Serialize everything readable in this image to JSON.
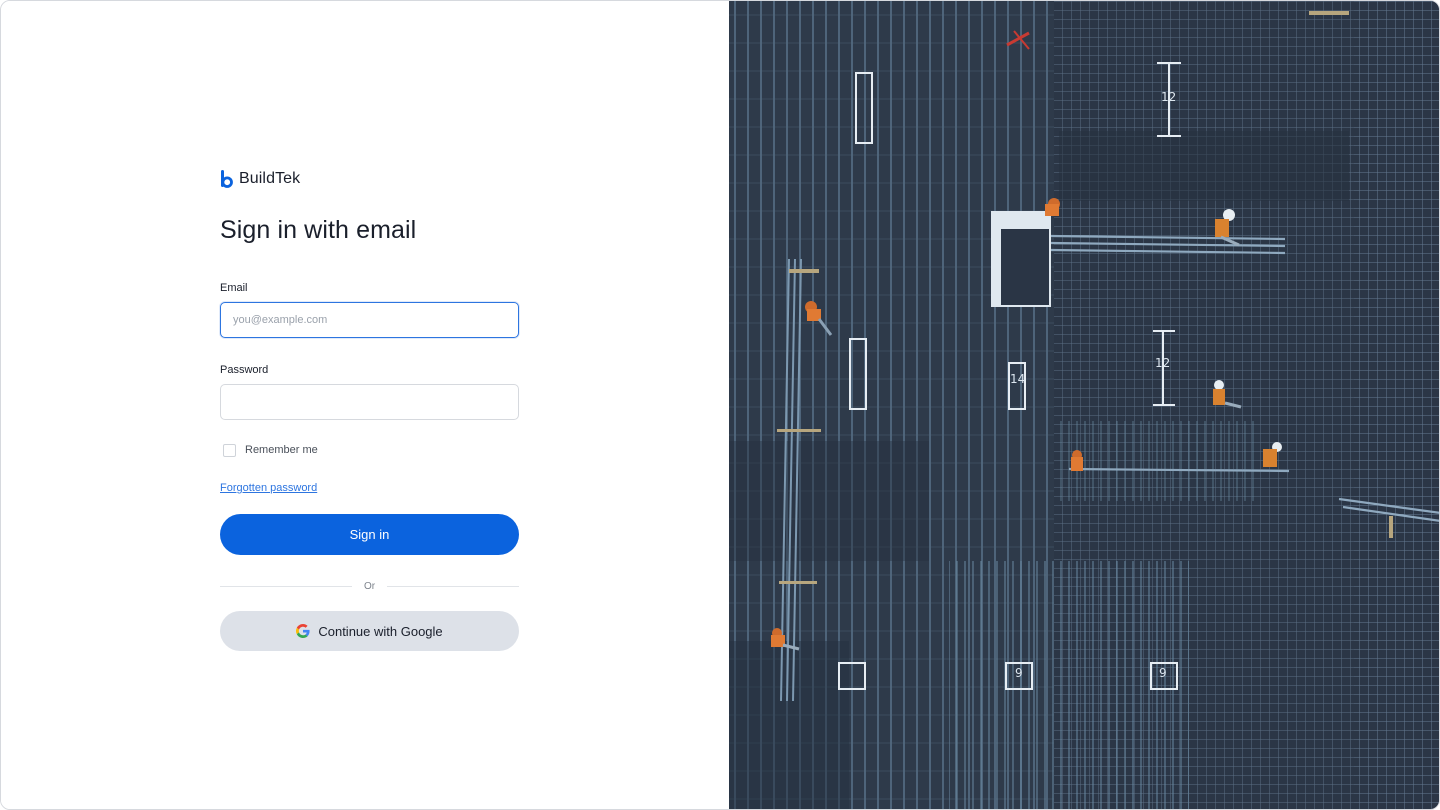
{
  "brand": {
    "name": "BuildTek",
    "accent": "#0b63de"
  },
  "form": {
    "title": "Sign in with email",
    "email": {
      "label": "Email",
      "placeholder": "you@example.com",
      "value": ""
    },
    "password": {
      "label": "Password",
      "value": ""
    },
    "remember_label": "Remember me",
    "remember_checked": false,
    "forgot_link": "Forgotten password",
    "signin_label": "Sign in",
    "divider_text": "Or",
    "google_label": "Continue with Google",
    "google_icon": "google-g-icon"
  },
  "hero": {
    "description_icon": "aerial-construction-photo",
    "grid_labels": [
      "12",
      "12",
      "14",
      "9",
      "9"
    ]
  }
}
